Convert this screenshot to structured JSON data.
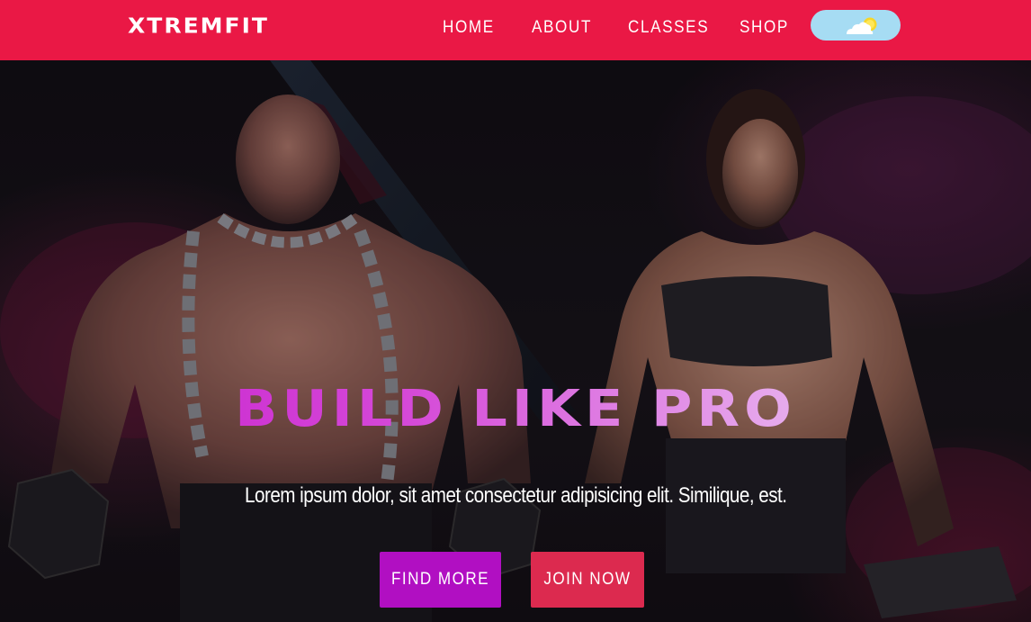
{
  "navbar": {
    "brand": "XTREMFIT",
    "links": [
      {
        "label": "HOME"
      },
      {
        "label": "ABOUT"
      },
      {
        "label": "CLASSES"
      },
      {
        "label": "SHOP"
      }
    ],
    "theme_toggle": {
      "icon": "partly-sunny-icon"
    }
  },
  "hero": {
    "title": "BUILD LIKE PRO",
    "text": "Lorem ipsum dolor, sit amet consectetur adipisicing elit. Similique, est.",
    "buttons": {
      "find_more": "FIND MORE",
      "join_now": "JOIN NOW"
    }
  },
  "colors": {
    "navbar_bg": "#ea1845",
    "find_more_bg": "#b10fc2",
    "join_now_bg": "#dc2a4f",
    "toggle_bg": "#a6dcf3",
    "title_gradient_start": "#c517cc",
    "title_gradient_end": "#f1d2f4"
  }
}
